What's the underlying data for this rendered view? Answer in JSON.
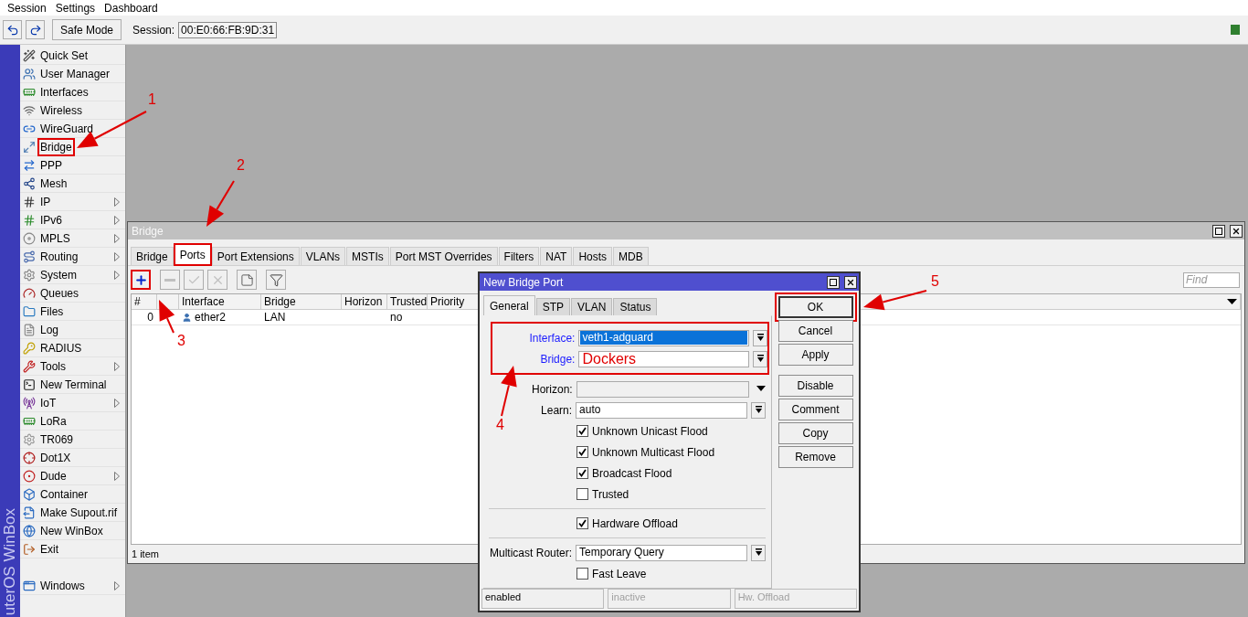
{
  "menu": [
    "Session",
    "Settings",
    "Dashboard"
  ],
  "toolbar": {
    "safe_mode": "Safe Mode",
    "session_label": "Session:",
    "session_value": "00:E0:66:FB:9D:31"
  },
  "side_banner": "uterOS WinBox",
  "sidebar": {
    "items": [
      {
        "label": "Quick Set",
        "submenu": false,
        "highlighted": false
      },
      {
        "label": "User Manager",
        "submenu": false,
        "highlighted": false
      },
      {
        "label": "Interfaces",
        "submenu": false,
        "highlighted": false
      },
      {
        "label": "Wireless",
        "submenu": false,
        "highlighted": false
      },
      {
        "label": "WireGuard",
        "submenu": false,
        "highlighted": false
      },
      {
        "label": "Bridge",
        "submenu": false,
        "highlighted": true
      },
      {
        "label": "PPP",
        "submenu": false,
        "highlighted": false
      },
      {
        "label": "Mesh",
        "submenu": false,
        "highlighted": false
      },
      {
        "label": "IP",
        "submenu": true,
        "highlighted": false
      },
      {
        "label": "IPv6",
        "submenu": true,
        "highlighted": false
      },
      {
        "label": "MPLS",
        "submenu": true,
        "highlighted": false
      },
      {
        "label": "Routing",
        "submenu": true,
        "highlighted": false
      },
      {
        "label": "System",
        "submenu": true,
        "highlighted": false
      },
      {
        "label": "Queues",
        "submenu": false,
        "highlighted": false
      },
      {
        "label": "Files",
        "submenu": false,
        "highlighted": false
      },
      {
        "label": "Log",
        "submenu": false,
        "highlighted": false
      },
      {
        "label": "RADIUS",
        "submenu": false,
        "highlighted": false
      },
      {
        "label": "Tools",
        "submenu": true,
        "highlighted": false
      },
      {
        "label": "New Terminal",
        "submenu": false,
        "highlighted": false
      },
      {
        "label": "IoT",
        "submenu": true,
        "highlighted": false
      },
      {
        "label": "LoRa",
        "submenu": false,
        "highlighted": false
      },
      {
        "label": "TR069",
        "submenu": false,
        "highlighted": false
      },
      {
        "label": "Dot1X",
        "submenu": false,
        "highlighted": false
      },
      {
        "label": "Dude",
        "submenu": true,
        "highlighted": false
      },
      {
        "label": "Container",
        "submenu": false,
        "highlighted": false
      },
      {
        "label": "Make Supout.rif",
        "submenu": false,
        "highlighted": false
      },
      {
        "label": "New WinBox",
        "submenu": false,
        "highlighted": false
      },
      {
        "label": "Exit",
        "submenu": false,
        "highlighted": false
      }
    ],
    "bottom_items": [
      {
        "label": "Windows",
        "submenu": true,
        "highlighted": false
      }
    ]
  },
  "bridge_window": {
    "title": "Bridge",
    "tabs": [
      {
        "label": "Bridge",
        "selected": false,
        "highlighted": false
      },
      {
        "label": "Ports",
        "selected": true,
        "highlighted": true
      },
      {
        "label": "Port Extensions",
        "selected": false,
        "highlighted": false
      },
      {
        "label": "VLANs",
        "selected": false,
        "highlighted": false
      },
      {
        "label": "MSTIs",
        "selected": false,
        "highlighted": false
      },
      {
        "label": "Port MST Overrides",
        "selected": false,
        "highlighted": false
      },
      {
        "label": "Filters",
        "selected": false,
        "highlighted": false
      },
      {
        "label": "NAT",
        "selected": false,
        "highlighted": false
      },
      {
        "label": "Hosts",
        "selected": false,
        "highlighted": false
      },
      {
        "label": "MDB",
        "selected": false,
        "highlighted": false
      }
    ],
    "tools": [
      {
        "kind": "add",
        "disabled": false,
        "highlighted": true
      },
      {
        "kind": "remove",
        "disabled": true,
        "highlighted": false
      },
      {
        "kind": "enable",
        "disabled": true,
        "highlighted": false
      },
      {
        "kind": "disable",
        "disabled": true,
        "highlighted": false
      },
      {
        "kind": "comment",
        "disabled": false,
        "highlighted": false
      },
      {
        "kind": "filter",
        "disabled": false,
        "highlighted": false
      }
    ],
    "find_placeholder": "Find",
    "columns": [
      "#",
      "Interface",
      "Bridge",
      "Horizon",
      "Trusted",
      "Priority"
    ],
    "rows": [
      {
        "number": "0",
        "interface": "ether2",
        "bridge": "LAN",
        "trusted": "no"
      }
    ],
    "status": "1 item"
  },
  "dialog": {
    "title": "New Bridge Port",
    "tabs": [
      {
        "label": "General",
        "selected": true
      },
      {
        "label": "STP",
        "selected": false
      },
      {
        "label": "VLAN",
        "selected": false
      },
      {
        "label": "Status",
        "selected": false
      }
    ],
    "groups": [
      {
        "highlighted": true,
        "rows": [
          {
            "kind": "dropdown",
            "label": "Interface:",
            "value": "veth1-adguard",
            "changed": true,
            "text_selected": true,
            "annotated": false
          },
          {
            "kind": "dropdown",
            "label": "Bridge:",
            "value": "Dockers",
            "changed": true,
            "text_selected": false,
            "annotated": true
          }
        ]
      },
      {
        "highlighted": false,
        "rows": [
          {
            "kind": "combo",
            "label": "Horizon:"
          },
          {
            "kind": "dropdown",
            "label": "Learn:",
            "value": "auto",
            "changed": false,
            "text_selected": false,
            "annotated": false
          },
          {
            "kind": "checkbox",
            "label": "Unknown Unicast Flood",
            "checked": true
          },
          {
            "kind": "checkbox",
            "label": "Unknown Multicast Flood",
            "checked": true
          },
          {
            "kind": "checkbox",
            "label": "Broadcast Flood",
            "checked": true
          },
          {
            "kind": "checkbox",
            "label": "Trusted",
            "checked": false
          }
        ]
      },
      {
        "highlighted": false,
        "rows": [
          {
            "kind": "checkbox",
            "label": "Hardware Offload",
            "checked": true
          }
        ]
      },
      {
        "highlighted": false,
        "rows": [
          {
            "kind": "dropdown",
            "label": "Multicast Router:",
            "value": "Temporary Query",
            "changed": false,
            "text_selected": false,
            "annotated": false
          },
          {
            "kind": "checkbox",
            "label": "Fast Leave",
            "checked": false
          }
        ]
      }
    ],
    "buttons": [
      [
        {
          "label": "OK",
          "highlighted": true
        },
        {
          "label": "Cancel",
          "highlighted": false
        },
        {
          "label": "Apply",
          "highlighted": false
        }
      ],
      [
        {
          "label": "Disable",
          "highlighted": false
        },
        {
          "label": "Comment",
          "highlighted": false
        },
        {
          "label": "Copy",
          "highlighted": false
        },
        {
          "label": "Remove",
          "highlighted": false
        }
      ]
    ],
    "status": [
      {
        "text": "enabled",
        "disabled": false
      },
      {
        "text": "inactive",
        "disabled": true
      },
      {
        "text": "Hw. Offload",
        "disabled": true
      }
    ]
  },
  "annotations": [
    {
      "label": "1"
    },
    {
      "label": "2"
    },
    {
      "label": "3"
    },
    {
      "label": "4"
    },
    {
      "label": "5"
    }
  ]
}
